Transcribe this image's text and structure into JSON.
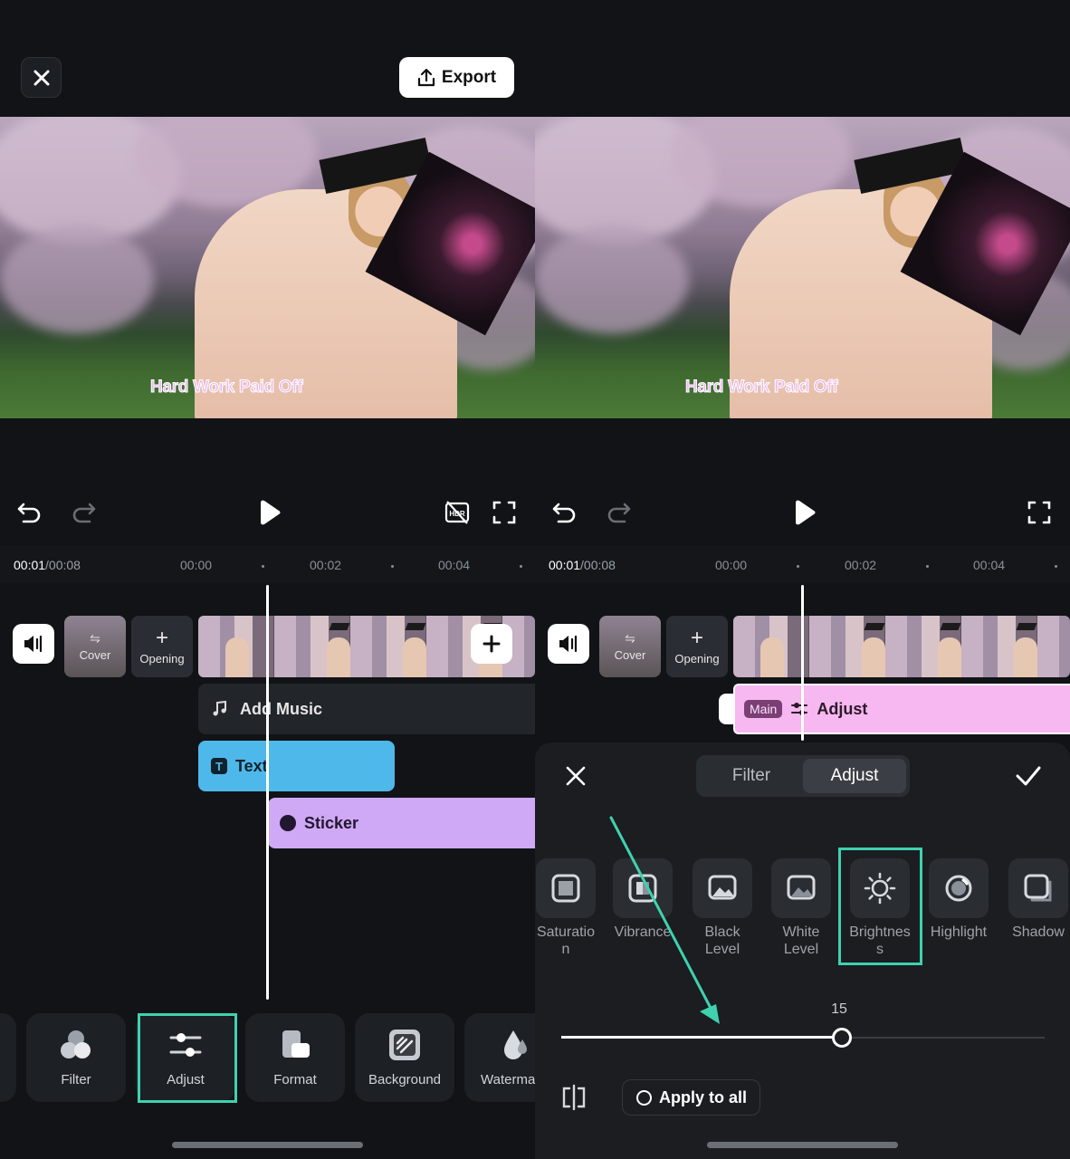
{
  "colors": {
    "highlight": "#3fd1b0",
    "text_track": "#4fb8ea",
    "sticker_track": "#cfa9f5",
    "adjust_track": "#f7b7f0"
  },
  "header": {
    "export_label": "Export",
    "close_icon": "close-icon"
  },
  "video": {
    "caption": "Hard Work Paid Off"
  },
  "timeline": {
    "current_time": "00:01",
    "total_time": "/00:08",
    "ticks": [
      "00:00",
      "00:02",
      "00:04"
    ]
  },
  "tiles": {
    "cover_label": "Cover",
    "opening_label": "Opening"
  },
  "left": {
    "tracks": {
      "music_label": "Add Music",
      "text_label": "Text",
      "sticker_label": "Sticker"
    },
    "tools": [
      {
        "label": "Filter",
        "icon": "filter-icon"
      },
      {
        "label": "Adjust",
        "icon": "adjust-icon"
      },
      {
        "label": "Format",
        "icon": "format-icon"
      },
      {
        "label": "Background",
        "icon": "background-icon"
      },
      {
        "label": "Waterma",
        "icon": "watermark-icon"
      }
    ]
  },
  "right": {
    "adjust_track": {
      "badge": "Main",
      "label": "Adjust"
    },
    "panel": {
      "tabs": [
        "Filter",
        "Adjust"
      ],
      "active_tab": "Adjust",
      "items": [
        {
          "label": "Saturatio\nn",
          "icon": "saturation-icon"
        },
        {
          "label": "Vibrance",
          "icon": "vibrance-icon"
        },
        {
          "label": "Black\nLevel",
          "icon": "black-level-icon"
        },
        {
          "label": "White\nLevel",
          "icon": "white-level-icon"
        },
        {
          "label": "Brightnes\ns",
          "icon": "brightness-icon"
        },
        {
          "label": "Highlight",
          "icon": "highlight-icon"
        },
        {
          "label": "Shadow",
          "icon": "shadow-icon"
        }
      ],
      "selected_item": "Brightnes\ns",
      "slider_value": "15",
      "slider_fraction": 0.58,
      "apply_all_label": "Apply to all"
    }
  }
}
